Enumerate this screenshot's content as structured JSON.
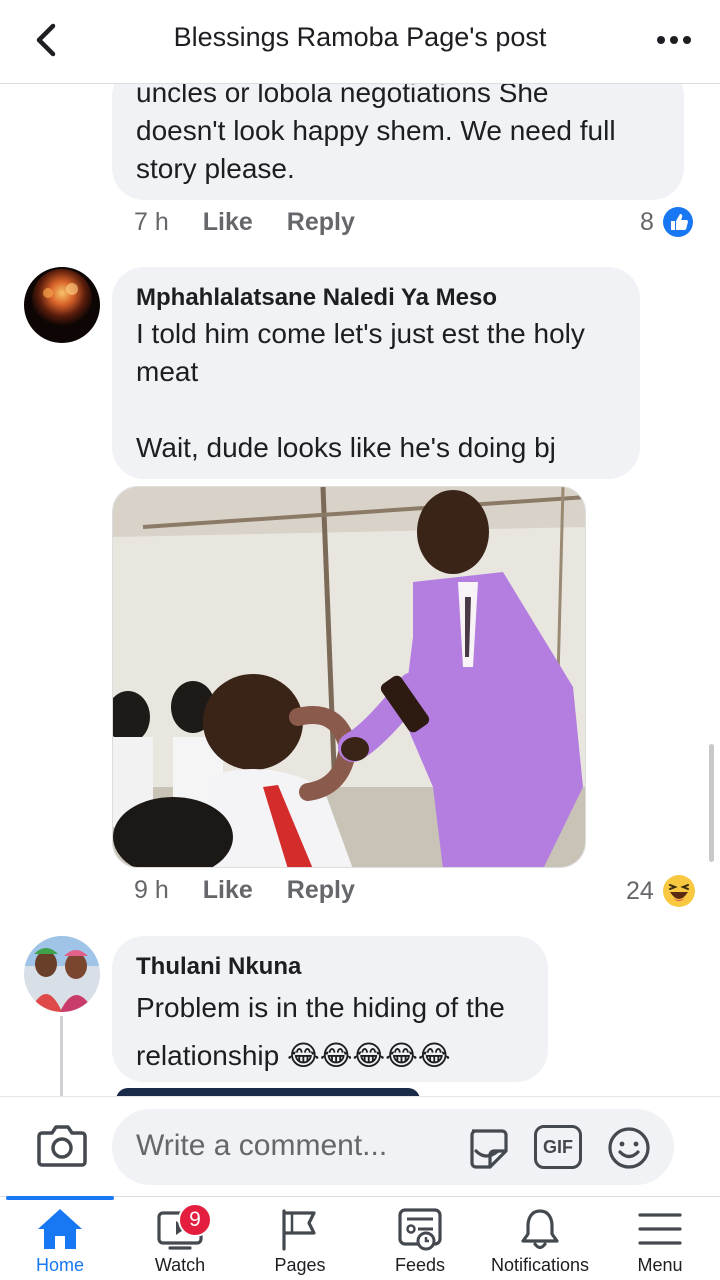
{
  "header": {
    "title": "Blessings Ramoba Page's post"
  },
  "comments": [
    {
      "text": "uncles or lobola negotiations She\ndoesn't look happy shem. We need full\nstory please.",
      "time": "7 h",
      "like_label": "Like",
      "reply_label": "Reply",
      "reaction_count": "8",
      "reaction_icon": "like-reaction-icon"
    },
    {
      "author": "Mphahlalatsane Naledi Ya Meso",
      "text": "I told him come let's just est the holy\nmeat\n\nWait, dude looks like he's doing bj",
      "time": "9 h",
      "like_label": "Like",
      "reply_label": "Reply",
      "reaction_count": "24",
      "reaction_icon": "haha-reaction-icon"
    },
    {
      "author": "Thulani Nkuna",
      "text": "Problem is in the hiding of the\nrelationship 😂😂😂😂😂"
    }
  ],
  "composer": {
    "placeholder": "Write a comment...",
    "gif_label": "GIF"
  },
  "tabs": [
    {
      "label": "Home",
      "active": true
    },
    {
      "label": "Watch",
      "badge": "9"
    },
    {
      "label": "Pages"
    },
    {
      "label": "Feeds"
    },
    {
      "label": "Notifications"
    },
    {
      "label": "Menu"
    }
  ],
  "colors": {
    "accent": "#1877f2",
    "badge": "#e41e3f",
    "bubble": "#f0f2f5",
    "muted": "#65676b"
  }
}
